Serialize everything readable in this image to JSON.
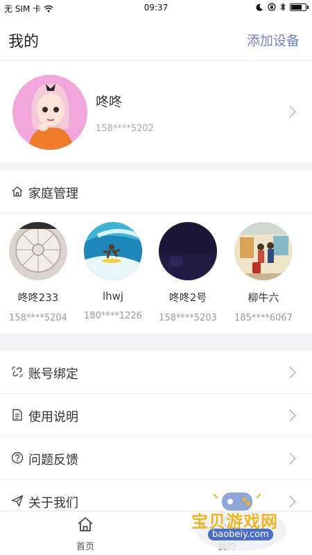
{
  "status_bar": {
    "carrier": "无 SIM 卡",
    "time": "09:37",
    "battery_level": 0.8
  },
  "header": {
    "title": "我的",
    "add_device": "添加设备"
  },
  "profile": {
    "name": "咚咚",
    "phone": "158****5202"
  },
  "family": {
    "title": "家庭管理",
    "members": [
      {
        "name": "咚咚233",
        "phone": "158****5204"
      },
      {
        "name": "lhwj",
        "phone": "180****1226"
      },
      {
        "name": "咚咚2号",
        "phone": "158****5203"
      },
      {
        "name": "柳牛六",
        "phone": "185****6067"
      }
    ]
  },
  "menu": {
    "items": [
      {
        "label": "账号绑定",
        "icon": "link-icon"
      },
      {
        "label": "使用说明",
        "icon": "document-icon"
      },
      {
        "label": "问题反馈",
        "icon": "question-icon"
      },
      {
        "label": "关于我们",
        "icon": "send-icon"
      }
    ]
  },
  "tabbar": {
    "items": [
      {
        "label": "首页",
        "icon": "home-icon"
      },
      {
        "label": "我的",
        "icon": "user-icon"
      }
    ]
  },
  "watermark": {
    "title": "宝贝游戏网",
    "url": "baobeiy.com"
  },
  "colors": {
    "accent": "#6f7fd1",
    "separator": "#f4f4f7",
    "watermark": "#f0b322"
  }
}
